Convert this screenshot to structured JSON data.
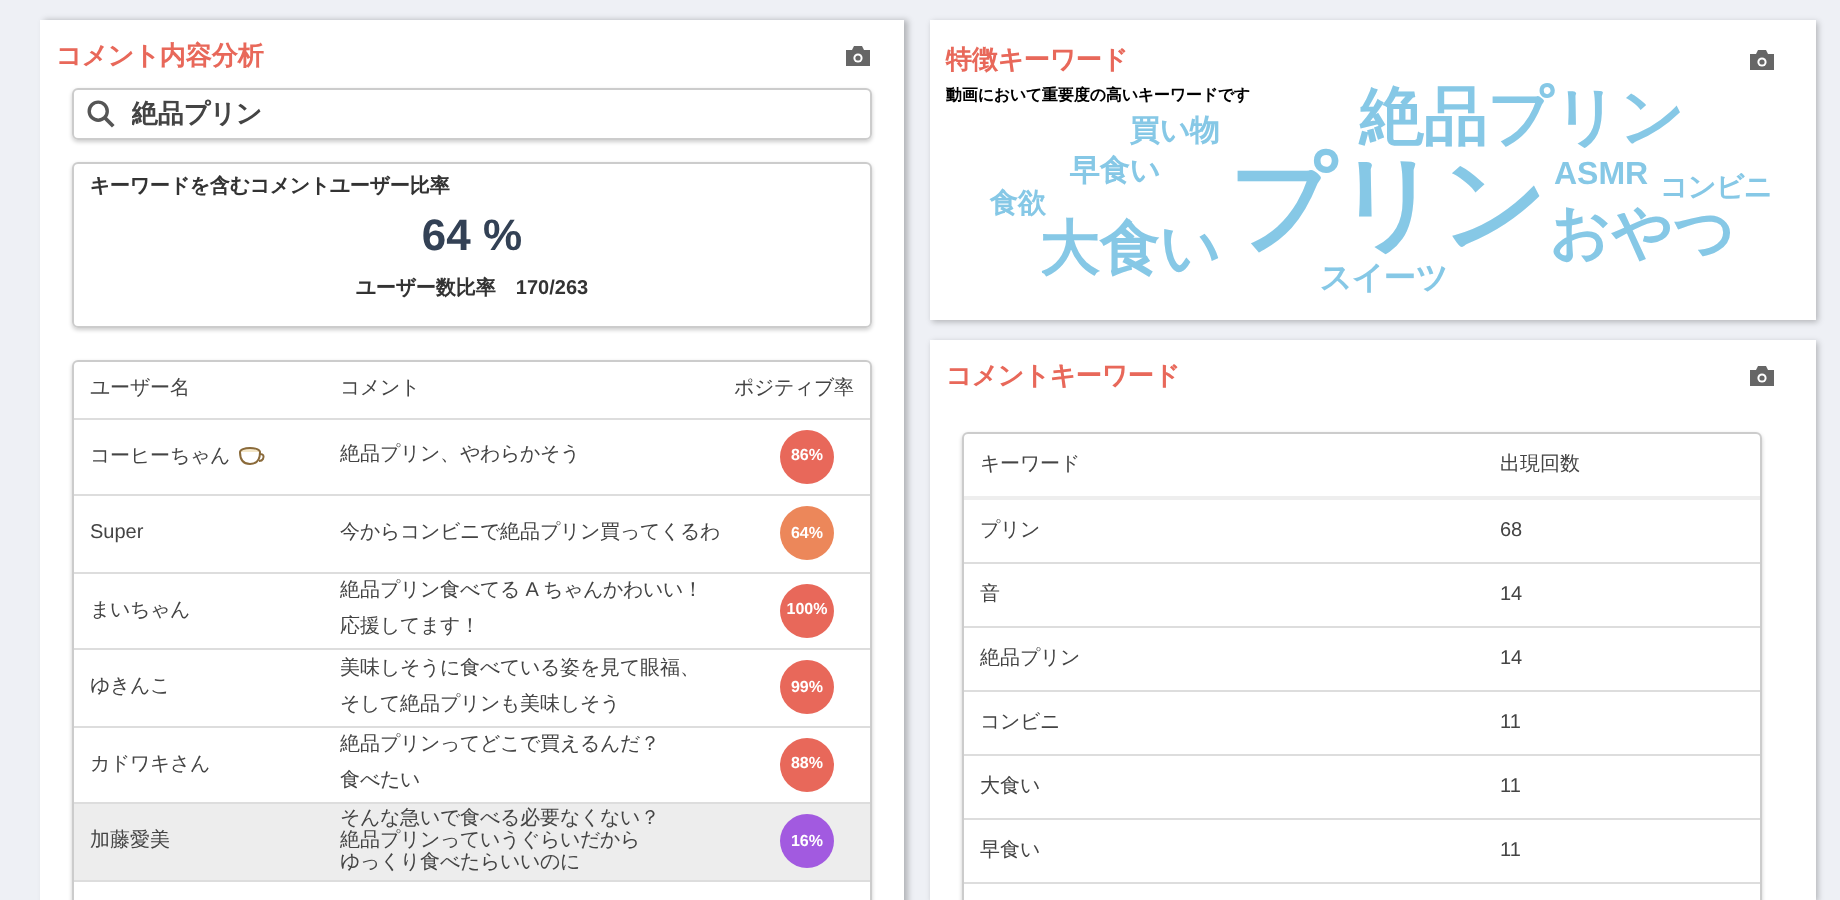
{
  "comment_analysis": {
    "title": "コメント内容分析",
    "search": {
      "value": "絶品プリン"
    },
    "ratio_card": {
      "title": "キーワードを含むコメントユーザー比率",
      "value": "64 %",
      "detail": "ユーザー数比率　170/263"
    },
    "table": {
      "columns": [
        "ユーザー名",
        "コメント",
        "ポジティブ率"
      ],
      "rows": [
        {
          "user": "コーヒーちゃん",
          "has_cup": true,
          "comment": [
            "絶品プリン、やわらかそう"
          ],
          "rate": "86%",
          "color": "#e8685a",
          "selected": false
        },
        {
          "user": "Super",
          "has_cup": false,
          "comment": [
            "今からコンビニで絶品プリン買ってくるわ"
          ],
          "rate": "64%",
          "color": "#ec875a",
          "selected": false
        },
        {
          "user": "まいちゃん",
          "has_cup": false,
          "comment": [
            "絶品プリン食べてる A ちゃんかわいい！",
            "応援してます！"
          ],
          "rate": "100%",
          "color": "#e8685a",
          "selected": false
        },
        {
          "user": "ゆきんこ",
          "has_cup": false,
          "comment": [
            "美味しそうに食べている姿を見て眼福、",
            "そして絶品プリンも美味しそう"
          ],
          "rate": "99%",
          "color": "#e8685a",
          "selected": false
        },
        {
          "user": "カドワキさん",
          "has_cup": false,
          "comment": [
            "絶品プリンってどこで買えるんだ？",
            "食べたい"
          ],
          "rate": "88%",
          "color": "#e8685a",
          "selected": false
        },
        {
          "user": "加藤愛美",
          "has_cup": false,
          "comment": [
            "そんな急いで食べる必要なくない？",
            "絶品プリンっていうぐらいだから",
            "ゆっくり食べたらいいのに"
          ],
          "rate": "16%",
          "color": "#a25ae0",
          "selected": true
        }
      ]
    }
  },
  "feature_keywords": {
    "title": "特徴キーワード",
    "subtitle": "動画において重要度の高いキーワードです",
    "words": [
      "買い物",
      "絶品プリン",
      "早食い",
      "食欲",
      "大食い",
      "プリン",
      "スイーツ",
      "ASMR",
      "コンビニ",
      "おやつ"
    ]
  },
  "comment_keywords": {
    "title": "コメントキーワード",
    "columns": [
      "キーワード",
      "出現回数"
    ],
    "rows": [
      {
        "keyword": "プリン",
        "count": "68"
      },
      {
        "keyword": "音",
        "count": "14"
      },
      {
        "keyword": "絶品プリン",
        "count": "14"
      },
      {
        "keyword": "コンビニ",
        "count": "11"
      },
      {
        "keyword": "大食い",
        "count": "11"
      },
      {
        "keyword": "早食い",
        "count": "11"
      }
    ]
  }
}
